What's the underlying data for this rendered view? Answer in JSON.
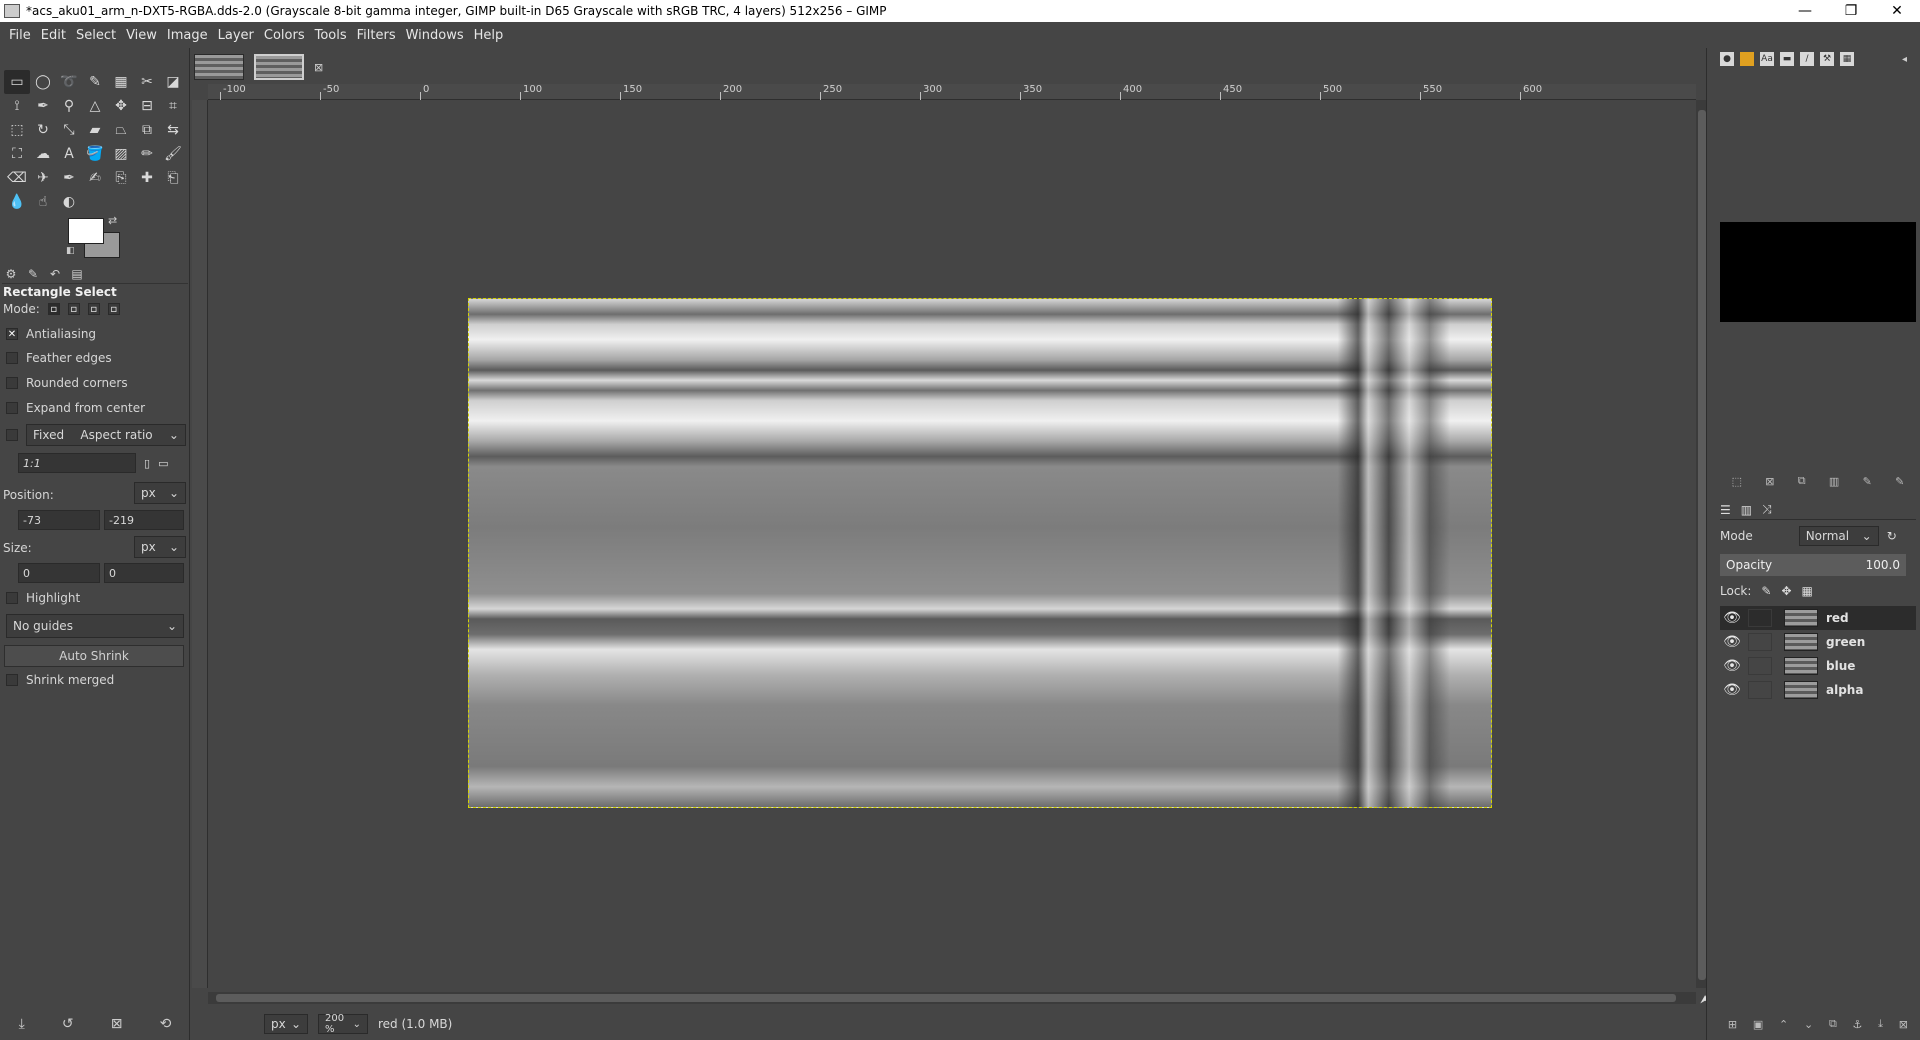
{
  "window": {
    "title": "*acs_aku01_arm_n-DXT5-RGBA.dds-2.0 (Grayscale 8-bit gamma integer, GIMP built-in D65 Grayscale with sRGB TRC, 4 layers) 512x256 – GIMP",
    "minimize": "—",
    "maximize": "❐",
    "close": "✕"
  },
  "menu": [
    "File",
    "Edit",
    "Select",
    "View",
    "Image",
    "Layer",
    "Colors",
    "Tools",
    "Filters",
    "Windows",
    "Help"
  ],
  "toolbox": {
    "tools": [
      {
        "icon": "rect-select-icon",
        "glyph": "▭",
        "active": true
      },
      {
        "icon": "ellipse-select-icon",
        "glyph": "◯"
      },
      {
        "icon": "free-select-icon",
        "glyph": "➰"
      },
      {
        "icon": "fuzzy-select-icon",
        "glyph": "✎"
      },
      {
        "icon": "select-by-color-icon",
        "glyph": "▦"
      },
      {
        "icon": "scissors-select-icon",
        "glyph": "✂"
      },
      {
        "icon": "foreground-select-icon",
        "glyph": "◪"
      },
      {
        "icon": "paths-icon",
        "glyph": "⟟"
      },
      {
        "icon": "color-picker-icon",
        "glyph": "✒"
      },
      {
        "icon": "zoom-icon",
        "glyph": "⚲"
      },
      {
        "icon": "measure-icon",
        "glyph": "△"
      },
      {
        "icon": "move-icon",
        "glyph": "✥"
      },
      {
        "icon": "align-icon",
        "glyph": "⊟"
      },
      {
        "icon": "crop-icon",
        "glyph": "⌗"
      },
      {
        "icon": "unified-transform-icon",
        "glyph": "⬚"
      },
      {
        "icon": "rotate-icon",
        "glyph": "↻"
      },
      {
        "icon": "scale-icon",
        "glyph": "⤡"
      },
      {
        "icon": "shear-icon",
        "glyph": "▰"
      },
      {
        "icon": "perspective-icon",
        "glyph": "⏢"
      },
      {
        "icon": "3d-transform-icon",
        "glyph": "⧉"
      },
      {
        "icon": "flip-icon",
        "glyph": "⇆"
      },
      {
        "icon": "cage-icon",
        "glyph": "⛶"
      },
      {
        "icon": "warp-icon",
        "glyph": "☁"
      },
      {
        "icon": "text-icon",
        "glyph": "A"
      },
      {
        "icon": "bucket-fill-icon",
        "glyph": "🪣"
      },
      {
        "icon": "gradient-icon",
        "glyph": "▨"
      },
      {
        "icon": "pencil-icon",
        "glyph": "✏"
      },
      {
        "icon": "paintbrush-icon",
        "glyph": "🖌"
      },
      {
        "icon": "eraser-icon",
        "glyph": "⌫"
      },
      {
        "icon": "airbrush-icon",
        "glyph": "✈"
      },
      {
        "icon": "ink-icon",
        "glyph": "✒"
      },
      {
        "icon": "mypaint-brush-icon",
        "glyph": "✍"
      },
      {
        "icon": "clone-icon",
        "glyph": "⎘"
      },
      {
        "icon": "heal-icon",
        "glyph": "✚"
      },
      {
        "icon": "perspective-clone-icon",
        "glyph": "⎗"
      },
      {
        "icon": "blur-icon",
        "glyph": "💧"
      },
      {
        "icon": "smudge-icon",
        "glyph": "☝"
      },
      {
        "icon": "dodge-burn-icon",
        "glyph": "◐"
      }
    ],
    "tool_options_title": "Rectangle Select",
    "mode_label": "Mode:",
    "antialiasing": "Antialiasing",
    "feather_edges": "Feather edges",
    "rounded_corners": "Rounded corners",
    "expand_from_center": "Expand from center",
    "fixed_label": "Fixed",
    "fixed_option": "Aspect ratio",
    "ratio_value": "1:1",
    "position_label": "Position:",
    "position_unit": "px",
    "position_x": "-73",
    "position_y": "-219",
    "size_label": "Size:",
    "size_unit": "px",
    "size_w": "0",
    "size_h": "0",
    "highlight": "Highlight",
    "guides": "No guides",
    "auto_shrink": "Auto Shrink",
    "shrink_merged": "Shrink merged"
  },
  "canvas": {
    "ruler_labels": [
      "-100",
      "-50",
      "0",
      "100",
      "150",
      "200",
      "250",
      "300",
      "350",
      "400",
      "450",
      "500",
      "550",
      "600"
    ],
    "status_unit": "px",
    "zoom": "200 %",
    "status_text": "red (1.0 MB)"
  },
  "layers_panel": {
    "mode_label": "Mode",
    "mode_value": "Normal",
    "opacity_label": "Opacity",
    "opacity_value": "100.0",
    "lock_label": "Lock:",
    "layers": [
      {
        "name": "red",
        "selected": true
      },
      {
        "name": "green",
        "selected": false
      },
      {
        "name": "blue",
        "selected": false
      },
      {
        "name": "alpha",
        "selected": false
      }
    ]
  }
}
